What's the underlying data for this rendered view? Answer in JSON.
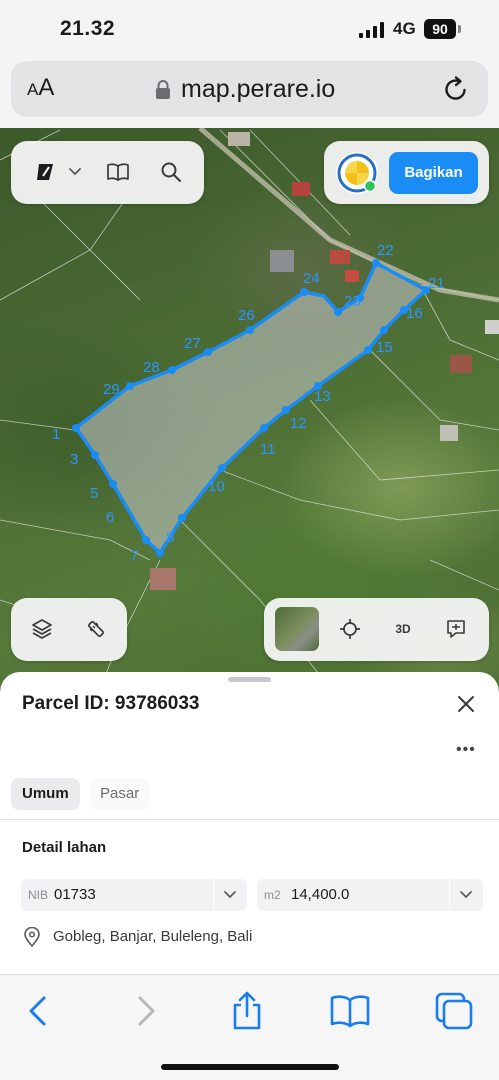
{
  "status_bar": {
    "time": "21.32",
    "network": "4G",
    "battery": "90"
  },
  "browser": {
    "text_size_label": "AA",
    "url": "map.perare.io"
  },
  "map": {
    "share_button_label": "Bagikan",
    "controls_3d_label": "3D",
    "parcel_outline_color": "#1a8cf5",
    "vertex_labels": [
      "1",
      "3",
      "5",
      "6",
      "7",
      "8",
      "10",
      "11",
      "12",
      "13",
      "15",
      "16",
      "21",
      "22",
      "23",
      "24",
      "26",
      "27",
      "28",
      "29"
    ]
  },
  "sheet": {
    "parcel_title": "Parcel ID: 93786033",
    "tabs": [
      {
        "label": "Umum"
      },
      {
        "label": "Pasar"
      }
    ],
    "section_title": "Detail lahan",
    "nib": {
      "label": "NIB",
      "value": "01733"
    },
    "area": {
      "label": "m2",
      "value": "14,400.0"
    },
    "location": "Gobleg, Banjar, Buleleng, Bali"
  },
  "toolbar": {
    "icons": [
      "back-icon",
      "forward-icon",
      "share-icon",
      "bookmarks-icon",
      "tabs-icon"
    ]
  }
}
